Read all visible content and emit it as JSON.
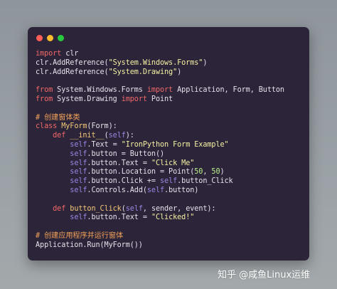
{
  "window": {
    "traffic_lights": [
      {
        "name": "close",
        "color": "#ff5f56"
      },
      {
        "name": "minimize",
        "color": "#ffbd2e"
      },
      {
        "name": "maximize",
        "color": "#27c93f"
      }
    ],
    "background_color": "#2c2438"
  },
  "code": {
    "language": "python",
    "lines": [
      [
        {
          "t": "kw",
          "v": "import"
        },
        {
          "t": "",
          "v": " clr"
        }
      ],
      [
        {
          "t": "",
          "v": "clr.AddReference("
        },
        {
          "t": "str",
          "v": "\"System.Windows.Forms\""
        },
        {
          "t": "",
          "v": ")"
        }
      ],
      [
        {
          "t": "",
          "v": "clr.AddReference("
        },
        {
          "t": "str",
          "v": "\"System.Drawing\""
        },
        {
          "t": "",
          "v": ")"
        }
      ],
      [],
      [
        {
          "t": "kw",
          "v": "from"
        },
        {
          "t": "",
          "v": " System.Windows.Forms "
        },
        {
          "t": "kw",
          "v": "import"
        },
        {
          "t": "",
          "v": " Application, Form, Button"
        }
      ],
      [
        {
          "t": "kw",
          "v": "from"
        },
        {
          "t": "",
          "v": " System.Drawing "
        },
        {
          "t": "kw",
          "v": "import"
        },
        {
          "t": "",
          "v": " Point"
        }
      ],
      [],
      [
        {
          "t": "cmt",
          "v": "# 创建窗体类"
        }
      ],
      [
        {
          "t": "kw",
          "v": "class"
        },
        {
          "t": "",
          "v": " "
        },
        {
          "t": "fn",
          "v": "MyForm"
        },
        {
          "t": "",
          "v": "(Form):"
        }
      ],
      [
        {
          "t": "",
          "v": "    "
        },
        {
          "t": "kw",
          "v": "def"
        },
        {
          "t": "",
          "v": " "
        },
        {
          "t": "fn",
          "v": "__init__"
        },
        {
          "t": "",
          "v": "("
        },
        {
          "t": "slf",
          "v": "self"
        },
        {
          "t": "",
          "v": "):"
        }
      ],
      [
        {
          "t": "",
          "v": "        "
        },
        {
          "t": "slf",
          "v": "self"
        },
        {
          "t": "",
          "v": ".Text = "
        },
        {
          "t": "str",
          "v": "\"IronPython Form Example\""
        }
      ],
      [
        {
          "t": "",
          "v": "        "
        },
        {
          "t": "slf",
          "v": "self"
        },
        {
          "t": "",
          "v": ".button = Button()"
        }
      ],
      [
        {
          "t": "",
          "v": "        "
        },
        {
          "t": "slf",
          "v": "self"
        },
        {
          "t": "",
          "v": ".button.Text = "
        },
        {
          "t": "str",
          "v": "\"Click Me\""
        }
      ],
      [
        {
          "t": "",
          "v": "        "
        },
        {
          "t": "slf",
          "v": "self"
        },
        {
          "t": "",
          "v": ".button.Location = Point("
        },
        {
          "t": "num",
          "v": "50"
        },
        {
          "t": "",
          "v": ", "
        },
        {
          "t": "num",
          "v": "50"
        },
        {
          "t": "",
          "v": ")"
        }
      ],
      [
        {
          "t": "",
          "v": "        "
        },
        {
          "t": "slf",
          "v": "self"
        },
        {
          "t": "",
          "v": ".button.Click += "
        },
        {
          "t": "slf",
          "v": "self"
        },
        {
          "t": "",
          "v": ".button_Click"
        }
      ],
      [
        {
          "t": "",
          "v": "        "
        },
        {
          "t": "slf",
          "v": "self"
        },
        {
          "t": "",
          "v": ".Controls.Add("
        },
        {
          "t": "slf",
          "v": "self"
        },
        {
          "t": "",
          "v": ".button)"
        }
      ],
      [],
      [
        {
          "t": "",
          "v": "    "
        },
        {
          "t": "kw",
          "v": "def"
        },
        {
          "t": "",
          "v": " "
        },
        {
          "t": "fn",
          "v": "button_Click"
        },
        {
          "t": "",
          "v": "("
        },
        {
          "t": "slf",
          "v": "self"
        },
        {
          "t": "",
          "v": ", sender, event):"
        }
      ],
      [
        {
          "t": "",
          "v": "        "
        },
        {
          "t": "slf",
          "v": "self"
        },
        {
          "t": "",
          "v": ".button.Text = "
        },
        {
          "t": "str",
          "v": "\"Clicked!\""
        }
      ],
      [],
      [
        {
          "t": "cmt",
          "v": "# 创建应用程序并运行窗体"
        }
      ],
      [
        {
          "t": "",
          "v": "Application.Run(MyForm())"
        }
      ]
    ]
  },
  "watermark": {
    "text": "知乎 @咸鱼Linux运维"
  }
}
